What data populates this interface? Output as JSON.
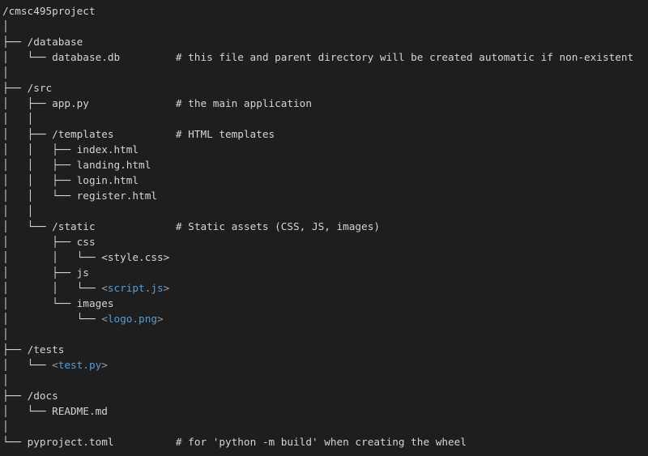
{
  "title": "/cmsc495project",
  "lines": [
    {
      "segments": [
        {
          "text": "/cmsc495project",
          "kind": "name"
        }
      ]
    },
    {
      "segments": [
        {
          "text": "│",
          "kind": "tree"
        }
      ]
    },
    {
      "segments": [
        {
          "text": "├── ",
          "kind": "tree"
        },
        {
          "text": "/database",
          "kind": "name"
        }
      ]
    },
    {
      "segments": [
        {
          "text": "│   └── ",
          "kind": "tree"
        },
        {
          "text": "database.db",
          "kind": "name"
        },
        {
          "text": "         ",
          "kind": "pad"
        },
        {
          "text": "# this file and parent directory will be created automatic if non-existent",
          "kind": "comment"
        }
      ]
    },
    {
      "segments": [
        {
          "text": "│",
          "kind": "tree"
        }
      ]
    },
    {
      "segments": [
        {
          "text": "├── ",
          "kind": "tree"
        },
        {
          "text": "/src",
          "kind": "name"
        }
      ]
    },
    {
      "segments": [
        {
          "text": "│   ├── ",
          "kind": "tree"
        },
        {
          "text": "app.py",
          "kind": "name"
        },
        {
          "text": "              ",
          "kind": "pad"
        },
        {
          "text": "# the main application",
          "kind": "comment"
        }
      ]
    },
    {
      "segments": [
        {
          "text": "│   │",
          "kind": "tree"
        }
      ]
    },
    {
      "segments": [
        {
          "text": "│   ├── ",
          "kind": "tree"
        },
        {
          "text": "/templates",
          "kind": "name"
        },
        {
          "text": "          ",
          "kind": "pad"
        },
        {
          "text": "# HTML templates",
          "kind": "comment"
        }
      ]
    },
    {
      "segments": [
        {
          "text": "│   │   ├── ",
          "kind": "tree"
        },
        {
          "text": "index.html",
          "kind": "name"
        }
      ]
    },
    {
      "segments": [
        {
          "text": "│   │   ├── ",
          "kind": "tree"
        },
        {
          "text": "landing.html",
          "kind": "name"
        }
      ]
    },
    {
      "segments": [
        {
          "text": "│   │   ├── ",
          "kind": "tree"
        },
        {
          "text": "login.html",
          "kind": "name"
        }
      ]
    },
    {
      "segments": [
        {
          "text": "│   │   └── ",
          "kind": "tree"
        },
        {
          "text": "register.html",
          "kind": "name"
        }
      ]
    },
    {
      "segments": [
        {
          "text": "│   │",
          "kind": "tree"
        }
      ]
    },
    {
      "segments": [
        {
          "text": "│   └── ",
          "kind": "tree"
        },
        {
          "text": "/static",
          "kind": "name"
        },
        {
          "text": "             ",
          "kind": "pad"
        },
        {
          "text": "# Static assets (CSS, JS, images)",
          "kind": "comment"
        }
      ]
    },
    {
      "segments": [
        {
          "text": "│       ├── ",
          "kind": "tree"
        },
        {
          "text": "css",
          "kind": "name"
        }
      ]
    },
    {
      "segments": [
        {
          "text": "│       │   └── ",
          "kind": "tree"
        },
        {
          "text": "<style.css>",
          "kind": "plain"
        }
      ]
    },
    {
      "segments": [
        {
          "text": "│       ├── ",
          "kind": "tree"
        },
        {
          "text": "js",
          "kind": "name"
        }
      ]
    },
    {
      "segments": [
        {
          "text": "│       │   └── ",
          "kind": "tree"
        },
        {
          "text": "<",
          "kind": "punct"
        },
        {
          "text": "script",
          "kind": "link"
        },
        {
          "text": ".",
          "kind": "punct"
        },
        {
          "text": "js",
          "kind": "link"
        },
        {
          "text": ">",
          "kind": "punct"
        }
      ]
    },
    {
      "segments": [
        {
          "text": "│       └── ",
          "kind": "tree"
        },
        {
          "text": "images",
          "kind": "name"
        }
      ]
    },
    {
      "segments": [
        {
          "text": "│           └── ",
          "kind": "tree"
        },
        {
          "text": "<",
          "kind": "punct"
        },
        {
          "text": "logo.png",
          "kind": "link"
        },
        {
          "text": ">",
          "kind": "punct"
        }
      ]
    },
    {
      "segments": [
        {
          "text": "│",
          "kind": "tree"
        }
      ]
    },
    {
      "segments": [
        {
          "text": "├── ",
          "kind": "tree"
        },
        {
          "text": "/tests",
          "kind": "name"
        }
      ]
    },
    {
      "segments": [
        {
          "text": "│   └── ",
          "kind": "tree"
        },
        {
          "text": "<",
          "kind": "punct"
        },
        {
          "text": "test.py",
          "kind": "link"
        },
        {
          "text": ">",
          "kind": "punct"
        }
      ]
    },
    {
      "segments": [
        {
          "text": "│",
          "kind": "tree"
        }
      ]
    },
    {
      "segments": [
        {
          "text": "├── ",
          "kind": "tree"
        },
        {
          "text": "/docs",
          "kind": "name"
        }
      ]
    },
    {
      "segments": [
        {
          "text": "│   └── ",
          "kind": "tree"
        },
        {
          "text": "README.md",
          "kind": "name"
        }
      ]
    },
    {
      "segments": [
        {
          "text": "│",
          "kind": "tree"
        }
      ]
    },
    {
      "segments": [
        {
          "text": "└── ",
          "kind": "tree"
        },
        {
          "text": "pyproject.toml",
          "kind": "name"
        },
        {
          "text": "          ",
          "kind": "pad"
        },
        {
          "text": "# for 'python -m build' when creating the wheel",
          "kind": "comment"
        }
      ]
    }
  ],
  "colors": {
    "background": "#1e1e1e",
    "text": "#d4d4d4",
    "link": "#569cd6",
    "punct": "#9c9c9c"
  }
}
